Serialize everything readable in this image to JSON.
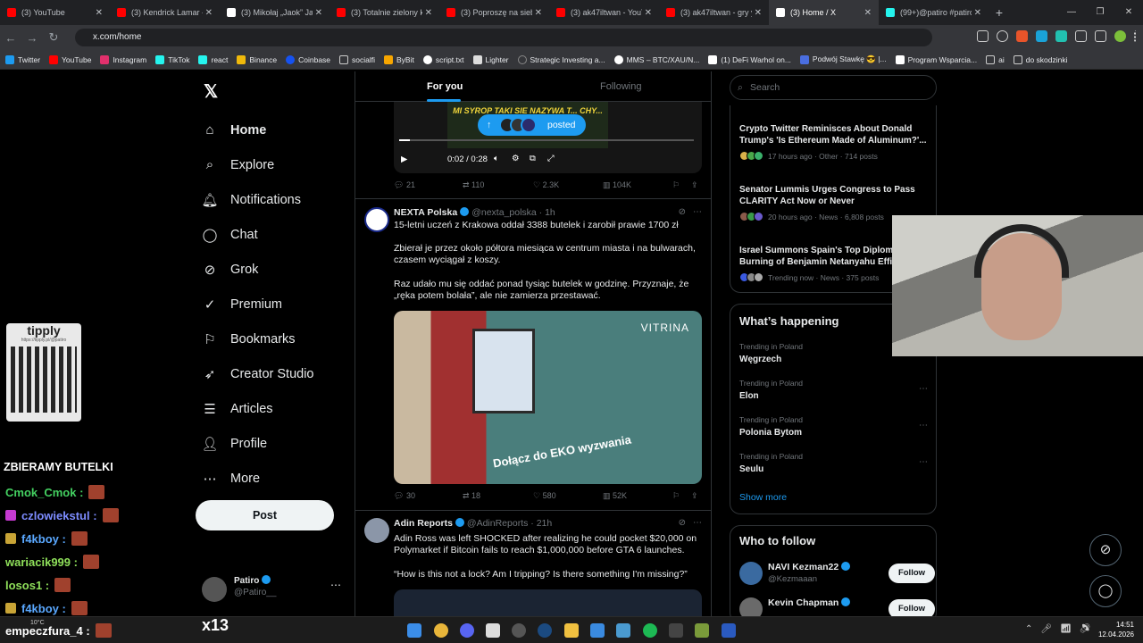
{
  "browser": {
    "tabs": [
      {
        "title": "(3) YouTube",
        "color": "#ff0000"
      },
      {
        "title": "(3) Kendrick Lamar - ",
        "color": "#ff0000"
      },
      {
        "title": "(3) Mikołaj „Jaok” Jan",
        "color": "#ffffff"
      },
      {
        "title": "(3) Totalnie zielony k",
        "color": "#ff0000"
      },
      {
        "title": "(3) Poproszę na siebie",
        "color": "#ff0000"
      },
      {
        "title": "(3) ak47iltwan - YouT",
        "color": "#ff0000"
      },
      {
        "title": "(3) ak47iltwan - gry y",
        "color": "#ff0000"
      },
      {
        "title": "(3) Home / X",
        "color": "#ffffff",
        "active": true
      },
      {
        "title": "(99+)@patiro #patiro",
        "color": "#25f4ee"
      }
    ],
    "url": "x.com/home",
    "bookmarks": [
      {
        "label": "Twitter",
        "color": "#1d9bf0"
      },
      {
        "label": "YouTube",
        "color": "#ff0000"
      },
      {
        "label": "Instagram",
        "color": "#e1306c"
      },
      {
        "label": "TikTok",
        "color": "#25f4ee"
      },
      {
        "label": "react",
        "color": "#25f4ee"
      },
      {
        "label": "Binance",
        "color": "#f0b90b"
      },
      {
        "label": "Coinbase",
        "color": "#1652f0"
      },
      {
        "label": "socialfi",
        "color": "#888888"
      },
      {
        "label": "ByBit",
        "color": "#f7a600"
      },
      {
        "label": "script.txt",
        "color": "#ffffff"
      },
      {
        "label": "Lighter",
        "color": "#dddddd"
      },
      {
        "label": "Strategic Investing a...",
        "color": "#888888"
      },
      {
        "label": "MMS – BTC/XAU/N...",
        "color": "#ffffff"
      },
      {
        "label": "(1) DeFi Warhol on...",
        "color": "#ffffff"
      },
      {
        "label": "Podwój Stawkę 😎 |...",
        "color": "#4a6ee0"
      },
      {
        "label": "Program Wsparcia...",
        "color": "#ffffff"
      },
      {
        "label": "ai",
        "color": "#888888"
      },
      {
        "label": "do skodzinki",
        "color": "#888888"
      }
    ]
  },
  "sidebar": {
    "items": [
      {
        "label": "Home",
        "icon": "⌂"
      },
      {
        "label": "Explore",
        "icon": "⌕"
      },
      {
        "label": "Notifications",
        "icon": "🔔︎"
      },
      {
        "label": "Chat",
        "icon": "◯"
      },
      {
        "label": "Grok",
        "icon": "⊘"
      },
      {
        "label": "Premium",
        "icon": "✓"
      },
      {
        "label": "Bookmarks",
        "icon": "⚐"
      },
      {
        "label": "Creator Studio",
        "icon": "➶"
      },
      {
        "label": "Articles",
        "icon": "☰"
      },
      {
        "label": "Profile",
        "icon": "👤︎"
      },
      {
        "label": "More",
        "icon": "⋯"
      }
    ],
    "post_label": "Post",
    "profile": {
      "name": "Patiro",
      "handle": "@Patiro__"
    }
  },
  "overlay": {
    "tippy_title": "tipply",
    "tippy_url": "https://tipply.pl/@patiro",
    "chat_header": "ZBIERAMY BUTELKI",
    "chat": [
      {
        "user": "Cmok_Cmok :",
        "color": "#44d161"
      },
      {
        "user": "czlowiekstul :",
        "color": "#7d8cff"
      },
      {
        "user": "f4kboy :",
        "color": "#5aa8ff"
      },
      {
        "user": "wariacik999 :",
        "color": "#8fe05a"
      },
      {
        "user": "losos1 :",
        "color": "#8fe05a"
      },
      {
        "user": "f4kboy :",
        "color": "#5aa8ff"
      },
      {
        "user": "empeczfura_4 :",
        "color": "#ffffff"
      }
    ],
    "x13": "x13",
    "weather": "10°C"
  },
  "feed": {
    "tab_for_you": "For you",
    "tab_following": "Following",
    "posted_pill": "posted",
    "video": {
      "caption": "MI SYROP TAKI SIE NAZYWA T... CHY...",
      "time": "0:02 / 0:28"
    },
    "tweet0_stats": {
      "replies": "21",
      "reposts": "110",
      "likes": "2.3K",
      "views": "104K"
    },
    "tweet1": {
      "name": "NEXTA Polska",
      "handle": "@nexta_polska · 1h",
      "p1": "15-letni uczeń z Krakowa oddał 3388 butelek i zarobił prawie 1700 zł",
      "p2": "Zbierał je przez około półtora miesiąca w centrum miasta i na bulwarach, czasem wyciągał z koszy.",
      "p3": "Raz udało mu się oddać ponad tysiąc butelek w godzinę. Przyznaje, że „ręka potem bolała”, ale nie zamierza przestawać.",
      "image_brand": "VITRINA",
      "image_caption": "Dołącz do EKO wyzwania",
      "replies": "30",
      "reposts": "18",
      "likes": "580",
      "views": "52K"
    },
    "tweet2": {
      "name": "Adin Reports",
      "handle": "@AdinReports · 21h",
      "p1": "Adin Ross was left SHOCKED after realizing he could pocket $20,000 on Polymarket if Bitcoin fails to reach $1,000,000 before GTA 6 launches.",
      "p2": "“How is this not a lock? Am I tripping? Is there something I'm missing?”"
    }
  },
  "right": {
    "search_placeholder": "Search",
    "news": [
      {
        "title": "Crypto Twitter Reminisces About Donald Trump's 'Is Ethereum Made of Aluminum?'...",
        "meta": "17 hours ago · Other · 714 posts"
      },
      {
        "title": "Senator Lummis Urges Congress to Pass CLARITY Act Now or Never",
        "meta": "20 hours ago · News · 6,808 posts"
      },
      {
        "title": "Israel Summons Spain's Top Diplom... Burning of Benjamin Netanyahu Effi...",
        "meta": "Trending now · News · 375 posts"
      }
    ],
    "happening_title": "What’s happening",
    "trends": [
      {
        "context": "Trending in Poland",
        "name": "Węgrzech"
      },
      {
        "context": "Trending in Poland",
        "name": "Elon"
      },
      {
        "context": "Trending in Poland",
        "name": "Polonia Bytom"
      },
      {
        "context": "Trending in Poland",
        "name": "Seulu"
      }
    ],
    "show_more": "Show more",
    "who_title": "Who to follow",
    "follow": [
      {
        "name": "NAVI Kezman22",
        "handle": "@Kezmaaan",
        "btn": "Follow"
      },
      {
        "name": "Kevin Chapman",
        "handle": "",
        "btn": "Follow"
      }
    ]
  },
  "taskbar": {
    "time": "14:51",
    "date": "12.04.2026"
  }
}
